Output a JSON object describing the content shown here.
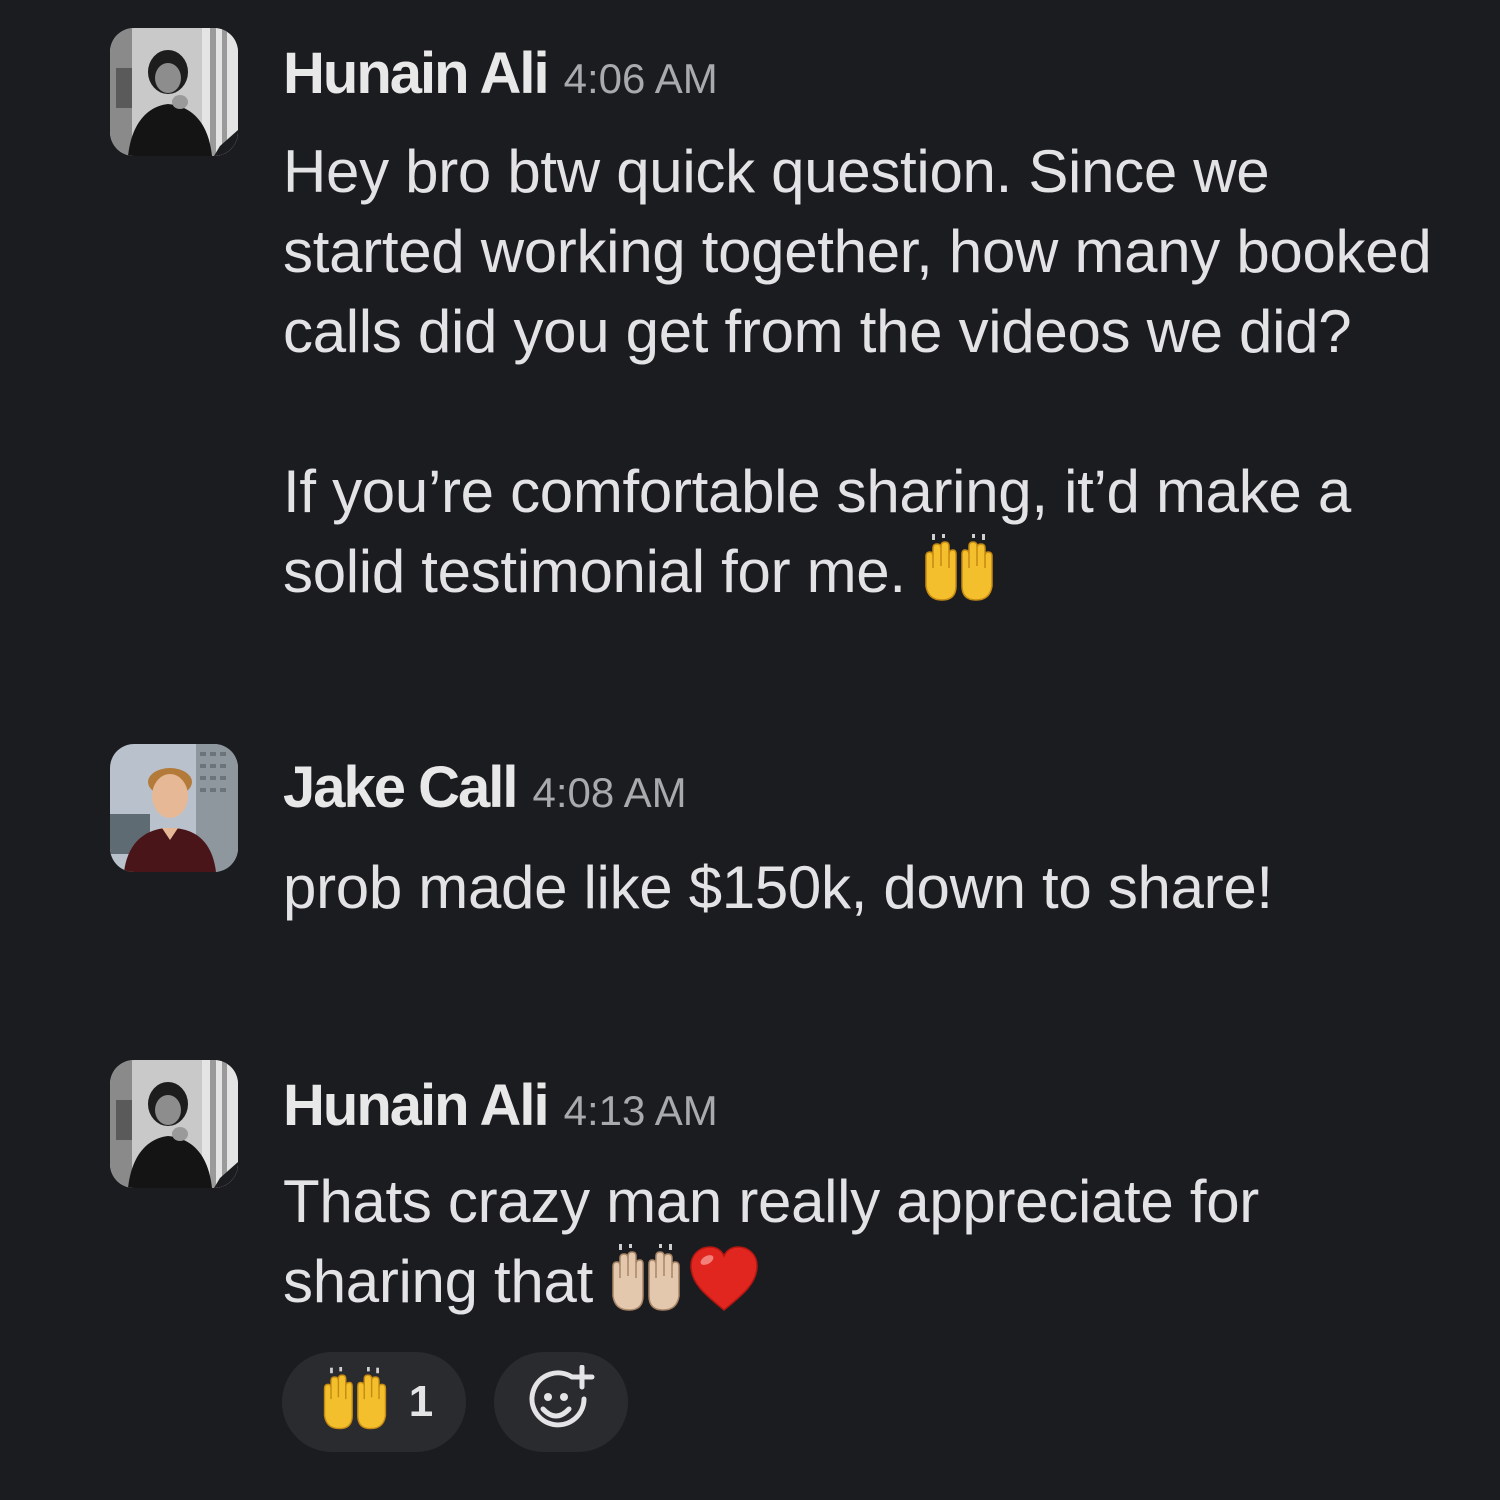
{
  "messages": [
    {
      "author": "Hunain Ali",
      "time": "4:06 AM",
      "text": "Hey bro btw quick question. Since we started working together, how many booked calls did you get from the videos we did?\n\nIf you’re comfortable sharing, it’d make a solid testimonial for me.",
      "trailing_emoji": [
        "raising-hands"
      ]
    },
    {
      "author": "Jake Call",
      "time": "4:08 AM",
      "text": "prob made like $150k, down to share!"
    },
    {
      "author": "Hunain Ali",
      "time": "4:13 AM",
      "text": "Thats crazy man really appreciate for sharing that",
      "trailing_emoji": [
        "raising-hands-light-skin",
        "red-heart"
      ]
    }
  ],
  "reactions": [
    {
      "emoji": "raising-hands",
      "count": "1"
    }
  ],
  "add_reaction_icon": "add-reaction-icon",
  "colors": {
    "background": "#1b1c20",
    "text": "#e3e3e5",
    "timestamp": "#a9aaad",
    "pill": "#2a2b2f",
    "emoji_yellow": "#f3bf2c",
    "emoji_light": "#e3c8ad",
    "heart": "#e0261f"
  }
}
